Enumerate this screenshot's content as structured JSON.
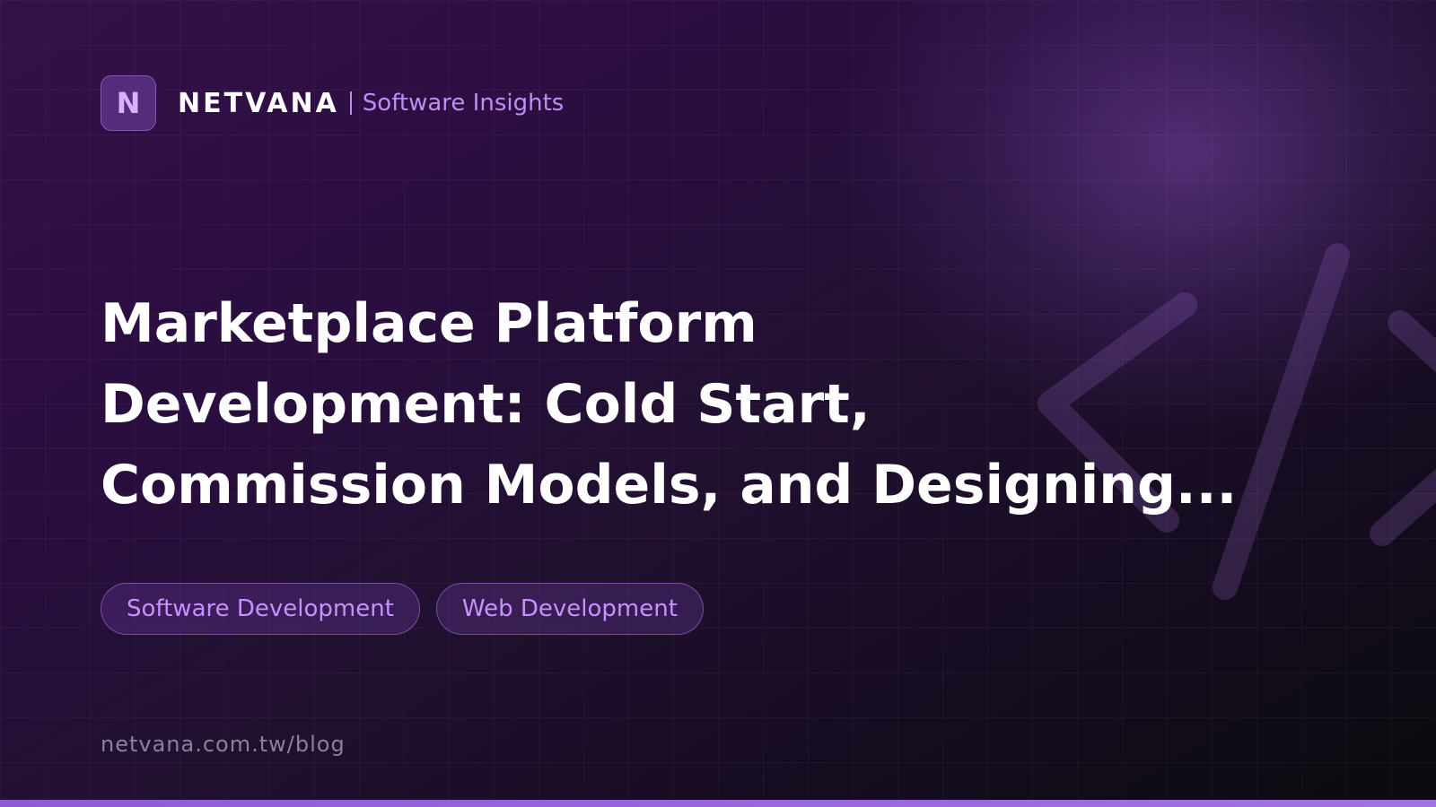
{
  "header": {
    "logo_letter": "N",
    "brand": "NETVANA",
    "subtitle": "Software Insights"
  },
  "title_lines": [
    "Marketplace Platform",
    "Development: Cold Start,",
    "Commission Models, and Designing..."
  ],
  "tags": [
    "Software Development",
    "Web Development"
  ],
  "footer": {
    "url": "netvana.com.tw/blog"
  },
  "decoration": {
    "icon": "code-brackets-icon"
  },
  "colors": {
    "accent": "#c08cf2",
    "tag_text": "#c890ff",
    "bottom_bar": "#9a66dc"
  }
}
